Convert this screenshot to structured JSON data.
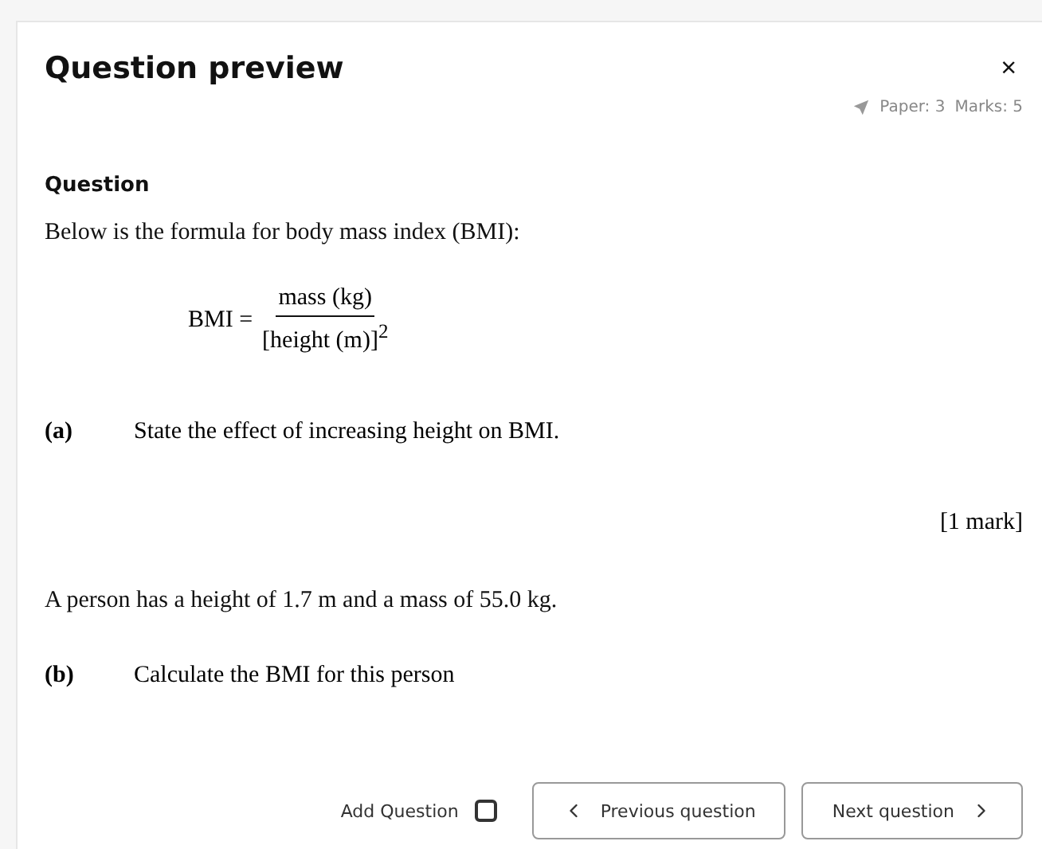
{
  "dialog": {
    "title": "Question preview",
    "close": "×",
    "paper": "Paper: 3",
    "marks": "Marks: 5"
  },
  "question": {
    "heading": "Question",
    "intro": "Below is the formula for body mass index (BMI):",
    "formula": {
      "lhs": "BMI =",
      "numerator": "mass (kg)",
      "denominator": "[height (m)]$^{2}$"
    },
    "parts": [
      {
        "label": "(a)",
        "text": "State the effect of increasing height on BMI.",
        "mark": "[1 mark]"
      }
    ],
    "info": "A person has a height of 1.7 m and a mass of 55.0 kg.",
    "part_b": {
      "label": "(b)",
      "text": "Calculate the BMI for this person"
    }
  },
  "footer": {
    "add_label": "Add Question",
    "add_checked": false,
    "previous": "Previous question",
    "next": "Next question"
  }
}
